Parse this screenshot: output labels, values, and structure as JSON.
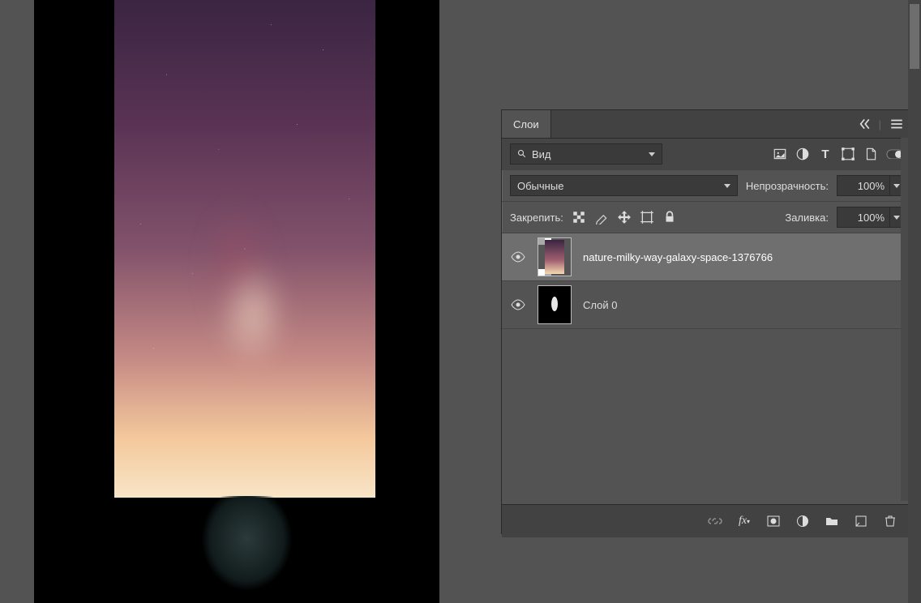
{
  "panel": {
    "tab": "Слои",
    "filter": {
      "kind": "Вид",
      "blend": "Обычные",
      "opacity_label": "Непрозрачность:",
      "opacity_value": "100%",
      "lock_label": "Закрепить:",
      "fill_label": "Заливка:",
      "fill_value": "100%"
    },
    "layers": [
      {
        "name": "nature-milky-way-galaxy-space-1376766",
        "visible": true,
        "selected": true
      },
      {
        "name": "Слой 0",
        "visible": true,
        "selected": false
      }
    ]
  }
}
